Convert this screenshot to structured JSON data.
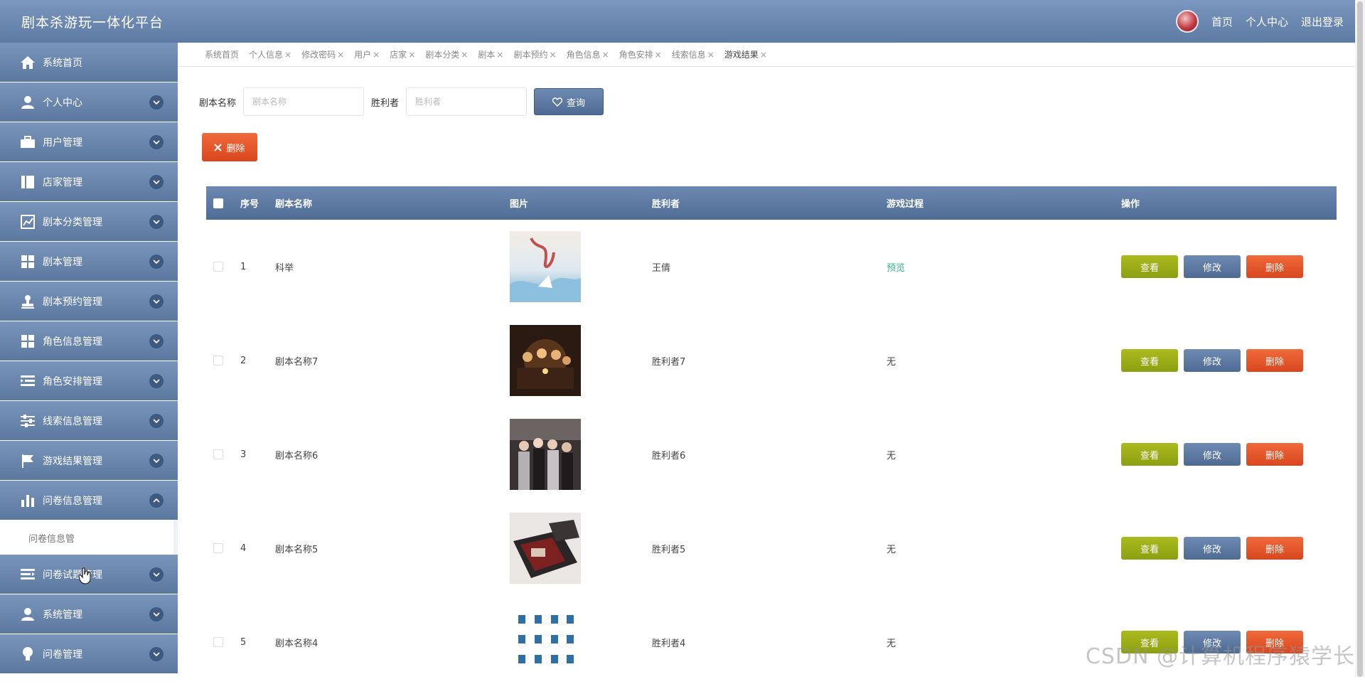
{
  "header": {
    "title": "剧本杀游玩一体化平台",
    "links": [
      "首页",
      "个人中心",
      "退出登录"
    ]
  },
  "sidebar": {
    "items": [
      {
        "label": "系统首页",
        "icon": "home-icon",
        "chevron": false
      },
      {
        "label": "个人中心",
        "icon": "person-icon",
        "chevron": true
      },
      {
        "label": "用户管理",
        "icon": "briefcase-icon",
        "chevron": true
      },
      {
        "label": "店家管理",
        "icon": "book-icon",
        "chevron": true
      },
      {
        "label": "剧本分类管理",
        "icon": "chart-line-icon",
        "chevron": true
      },
      {
        "label": "剧本管理",
        "icon": "grid-icon",
        "chevron": true
      },
      {
        "label": "剧本预约管理",
        "icon": "stamp-icon",
        "chevron": true
      },
      {
        "label": "角色信息管理",
        "icon": "grid-icon",
        "chevron": true
      },
      {
        "label": "角色安排管理",
        "icon": "list-indent-icon",
        "chevron": true
      },
      {
        "label": "线索信息管理",
        "icon": "sliders-icon",
        "chevron": true
      },
      {
        "label": "游戏结果管理",
        "icon": "flag-icon",
        "chevron": true
      },
      {
        "label": "问卷信息管理",
        "icon": "bar-chart-icon",
        "chevron": true,
        "expanded": true
      }
    ],
    "submenu_label": "问卷信息管",
    "items_after": [
      {
        "label": "问卷试题管理",
        "icon": "list-icon",
        "chevron": true
      },
      {
        "label": "系统管理",
        "icon": "person-icon",
        "chevron": true
      },
      {
        "label": "问卷管理",
        "icon": "bulb-icon",
        "chevron": true
      }
    ]
  },
  "tabs": [
    "系统首页",
    "个人信息",
    "修改密码",
    "用户",
    "店家",
    "剧本分类",
    "剧本",
    "剧本预约",
    "角色信息",
    "角色安排",
    "线索信息",
    "游戏结果"
  ],
  "tab_close": "×",
  "search": {
    "label1": "剧本名称",
    "placeholder1": "剧本名称",
    "label2": "胜利者",
    "placeholder2": "胜利者",
    "query_label": "查询"
  },
  "delete_label": "删除",
  "table": {
    "headers": [
      "序号",
      "剧本名称",
      "图片",
      "胜利者",
      "游戏过程",
      "操作"
    ],
    "rows": [
      {
        "index": "1",
        "name": "科举",
        "winner": "王倩",
        "process": "预览"
      },
      {
        "index": "2",
        "name": "剧本名称7",
        "winner": "胜利者7",
        "process": "无"
      },
      {
        "index": "3",
        "name": "剧本名称6",
        "winner": "胜利者6",
        "process": "无"
      },
      {
        "index": "4",
        "name": "剧本名称5",
        "winner": "胜利者5",
        "process": "无"
      },
      {
        "index": "5",
        "name": "剧本名称4",
        "winner": "胜利者4",
        "process": "无"
      }
    ],
    "ops": {
      "view": "查看",
      "edit": "修改",
      "del": "删除"
    }
  },
  "watermark": "CSDN @计算机程序猿学长",
  "colors": {
    "accent": "#5d7aa3",
    "danger": "#e05228",
    "view": "#9aae18",
    "preview": "#3cb38a"
  }
}
